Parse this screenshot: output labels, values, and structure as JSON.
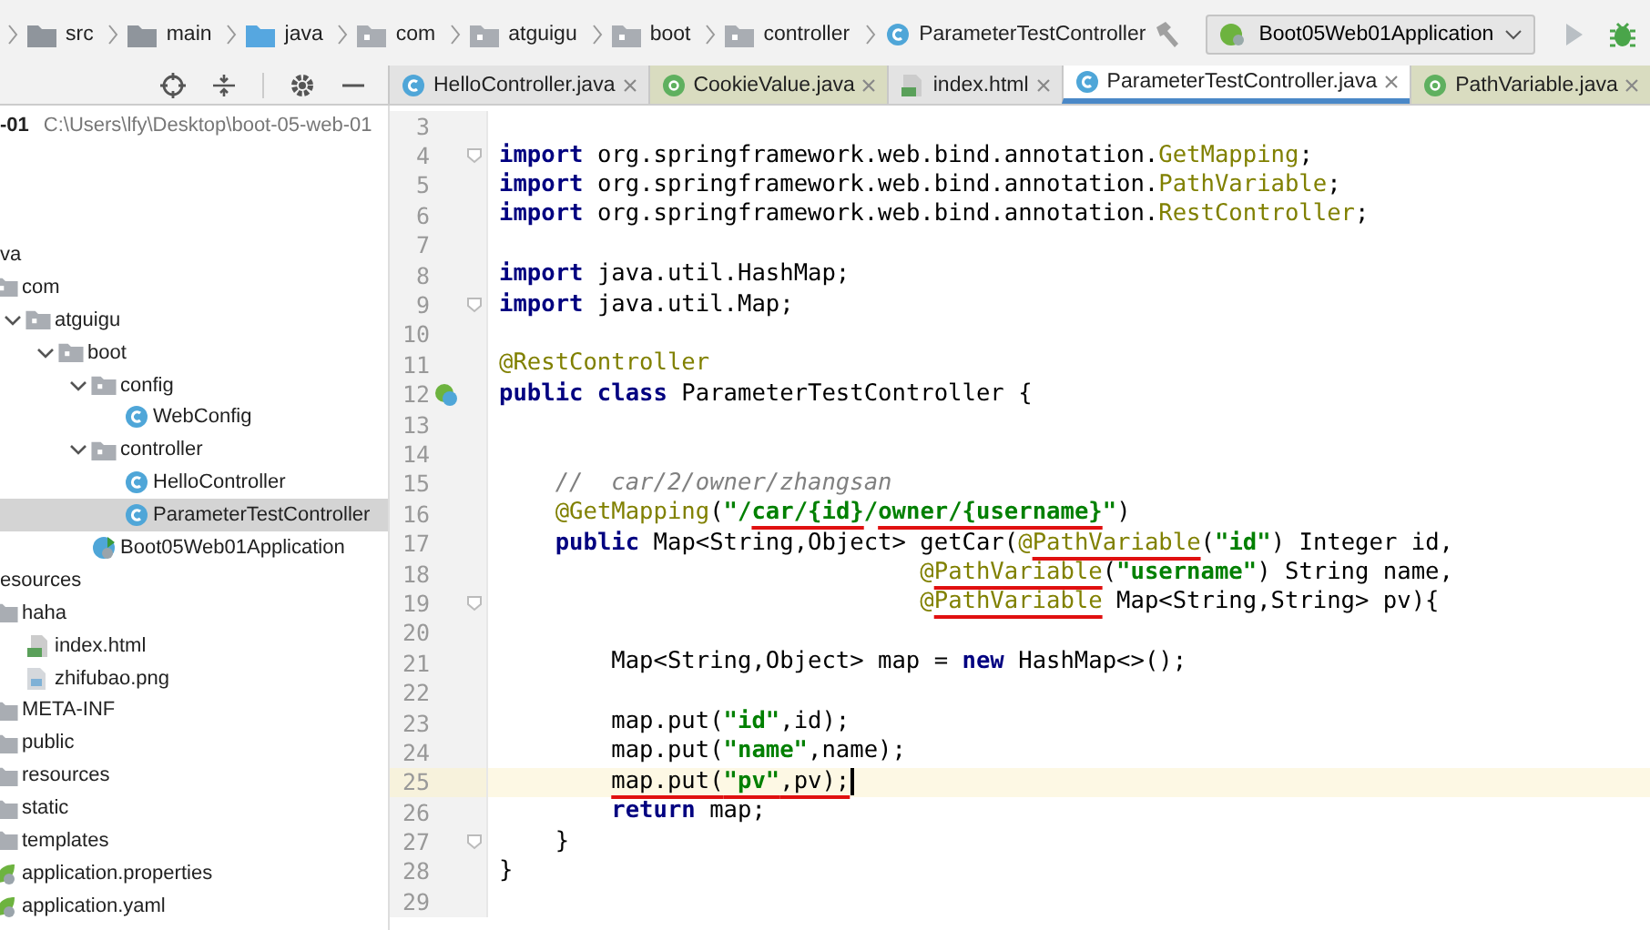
{
  "breadcrumb": [
    {
      "label": "src",
      "kind": "folder"
    },
    {
      "label": "main",
      "kind": "folder"
    },
    {
      "label": "java",
      "kind": "source"
    },
    {
      "label": "com",
      "kind": "package"
    },
    {
      "label": "atguigu",
      "kind": "package"
    },
    {
      "label": "boot",
      "kind": "package"
    },
    {
      "label": "controller",
      "kind": "package"
    },
    {
      "label": "ParameterTestController",
      "kind": "class"
    }
  ],
  "run_config": {
    "label": "Boot05Web01Application"
  },
  "tabs": [
    {
      "label": "HelloController.java",
      "kind": "class",
      "selected": false
    },
    {
      "label": "CookieValue.java",
      "kind": "annotation",
      "selected": false
    },
    {
      "label": "index.html",
      "kind": "html",
      "selected": false
    },
    {
      "label": "ParameterTestController.java",
      "kind": "class",
      "selected": true
    },
    {
      "label": "PathVariable.java",
      "kind": "annotation",
      "selected": false
    }
  ],
  "project": {
    "name": "-01",
    "path": "C:\\Users\\lfy\\Desktop\\boot-05-web-01"
  },
  "tree": [
    {
      "label": "va",
      "kind": "none",
      "selected": false,
      "children": [
        {
          "label": "com",
          "kind": "package",
          "selected": false,
          "children": [
            {
              "label": "atguigu",
              "kind": "package",
              "expanded": true,
              "selected": false,
              "children": [
                {
                  "label": "boot",
                  "kind": "package",
                  "expanded": true,
                  "selected": false,
                  "children": [
                    {
                      "label": "config",
                      "kind": "package",
                      "expanded": true,
                      "selected": false,
                      "children": [
                        {
                          "label": "WebConfig",
                          "kind": "class",
                          "selected": false
                        }
                      ]
                    },
                    {
                      "label": "controller",
                      "kind": "package",
                      "expanded": true,
                      "selected": false,
                      "children": [
                        {
                          "label": "HelloController",
                          "kind": "class",
                          "selected": false
                        },
                        {
                          "label": "ParameterTestController",
                          "kind": "class",
                          "selected": true
                        }
                      ]
                    },
                    {
                      "label": "Boot05Web01Application",
                      "kind": "app",
                      "selected": false
                    }
                  ]
                }
              ]
            }
          ]
        }
      ]
    },
    {
      "label": "esources",
      "kind": "none",
      "selected": false,
      "children": [
        {
          "label": "haha",
          "kind": "folder",
          "selected": false,
          "children": [
            {
              "label": "index.html",
              "kind": "html",
              "selected": false
            },
            {
              "label": "zhifubao.png",
              "kind": "image",
              "selected": false
            }
          ]
        },
        {
          "label": "META-INF",
          "kind": "folder",
          "selected": false
        },
        {
          "label": "public",
          "kind": "folder",
          "selected": false
        },
        {
          "label": "resources",
          "kind": "folder",
          "selected": false
        },
        {
          "label": "static",
          "kind": "folder",
          "selected": false
        },
        {
          "label": "templates",
          "kind": "folder",
          "selected": false
        },
        {
          "label": "application.properties",
          "kind": "config",
          "selected": false
        },
        {
          "label": "application.yaml",
          "kind": "config",
          "selected": false
        }
      ]
    }
  ],
  "code": [
    {
      "number": "3"
    },
    {
      "number": "4",
      "fold": true,
      "tokens": [
        {
          "t": "import",
          "kind": "keyword"
        },
        {
          "t": " org.springframework.web.bind.annotation.",
          "kind": "plain"
        },
        {
          "t": "GetMapping",
          "kind": "annotation"
        },
        {
          "t": ";",
          "kind": "plain"
        }
      ]
    },
    {
      "number": "5",
      "tokens": [
        {
          "t": "import",
          "kind": "keyword"
        },
        {
          "t": " org.springframework.web.bind.annotation.",
          "kind": "plain"
        },
        {
          "t": "PathVariable",
          "kind": "annotation"
        },
        {
          "t": ";",
          "kind": "plain"
        }
      ]
    },
    {
      "number": "6",
      "tokens": [
        {
          "t": "import",
          "kind": "keyword"
        },
        {
          "t": " org.springframework.web.bind.annotation.",
          "kind": "plain"
        },
        {
          "t": "RestController",
          "kind": "annotation"
        },
        {
          "t": ";",
          "kind": "plain"
        }
      ]
    },
    {
      "number": "7"
    },
    {
      "number": "8",
      "tokens": [
        {
          "t": "import",
          "kind": "keyword"
        },
        {
          "t": " java.util.HashMap;",
          "kind": "plain"
        }
      ]
    },
    {
      "number": "9",
      "fold": true,
      "tokens": [
        {
          "t": "import",
          "kind": "keyword"
        },
        {
          "t": " java.util.Map;",
          "kind": "plain"
        }
      ]
    },
    {
      "number": "10"
    },
    {
      "number": "11",
      "tokens": [
        {
          "t": "@RestController",
          "kind": "annotation"
        }
      ]
    },
    {
      "number": "12",
      "gutter": {
        "kind": "bean"
      },
      "tokens": [
        {
          "t": "public class",
          "kind": "keyword"
        },
        {
          "t": " ParameterTestController {",
          "kind": "plain"
        }
      ]
    },
    {
      "number": "13"
    },
    {
      "number": "14"
    },
    {
      "number": "15",
      "tokens": [
        {
          "t": "    //  car/2/owner/zhangsan",
          "kind": "comment"
        }
      ]
    },
    {
      "number": "16",
      "tokens": [
        {
          "t": "    @GetMapping",
          "kind": "annotation"
        },
        {
          "t": "(",
          "kind": "plain"
        },
        {
          "t": "\"/",
          "kind": "string"
        },
        {
          "t": "car/{id}",
          "kind": "string",
          "marked": true
        },
        {
          "t": "/",
          "kind": "string"
        },
        {
          "t": "owner/{username}",
          "kind": "string",
          "marked": true
        },
        {
          "t": "\"",
          "kind": "string"
        },
        {
          "t": ")",
          "kind": "plain"
        }
      ]
    },
    {
      "number": "17",
      "tokens": [
        {
          "t": "    public",
          "kind": "keyword"
        },
        {
          "t": " Map<String,Object> getCar(",
          "kind": "plain"
        },
        {
          "t": "@",
          "kind": "annotation"
        },
        {
          "t": "PathVariable",
          "kind": "annotation",
          "marked": true
        },
        {
          "t": "(",
          "kind": "plain"
        },
        {
          "t": "\"id\"",
          "kind": "string"
        },
        {
          "t": ") Integer id,",
          "kind": "plain"
        }
      ]
    },
    {
      "number": "18",
      "tokens": [
        {
          "t": "                              @",
          "kind": "annotation"
        },
        {
          "t": "PathVariable",
          "kind": "annotation",
          "marked": true
        },
        {
          "t": "(",
          "kind": "plain"
        },
        {
          "t": "\"username\"",
          "kind": "string"
        },
        {
          "t": ") String name,",
          "kind": "plain"
        }
      ]
    },
    {
      "number": "19",
      "fold": true,
      "tokens": [
        {
          "t": "                              @",
          "kind": "annotation"
        },
        {
          "t": "PathVariable",
          "kind": "annotation",
          "marked": true
        },
        {
          "t": " Map<String,String> pv){",
          "kind": "plain"
        }
      ]
    },
    {
      "number": "20"
    },
    {
      "number": "21",
      "tokens": [
        {
          "t": "        Map<String,Object> map = ",
          "kind": "plain"
        },
        {
          "t": "new",
          "kind": "keyword"
        },
        {
          "t": " HashMap<>();",
          "kind": "plain"
        }
      ]
    },
    {
      "number": "22"
    },
    {
      "number": "23",
      "tokens": [
        {
          "t": "        map.put(",
          "kind": "plain"
        },
        {
          "t": "\"id\"",
          "kind": "string"
        },
        {
          "t": ",id);",
          "kind": "plain"
        }
      ]
    },
    {
      "number": "24",
      "tokens": [
        {
          "t": "        map.put(",
          "kind": "plain"
        },
        {
          "t": "\"name\"",
          "kind": "string"
        },
        {
          "t": ",name);",
          "kind": "plain"
        }
      ]
    },
    {
      "number": "25",
      "current": true,
      "caret": true,
      "tokens": [
        {
          "t": "        map.put(",
          "kind": "plain",
          "marked": true
        },
        {
          "t": "\"pv\"",
          "kind": "string",
          "marked": true
        },
        {
          "t": ",pv);",
          "kind": "plain",
          "marked": true
        }
      ]
    },
    {
      "number": "26",
      "tokens": [
        {
          "t": "        return",
          "kind": "keyword"
        },
        {
          "t": " map;",
          "kind": "plain"
        }
      ]
    },
    {
      "number": "27",
      "fold": true,
      "tokens": [
        {
          "t": "    }",
          "kind": "plain"
        }
      ]
    },
    {
      "number": "28",
      "tokens": [
        {
          "t": "}",
          "kind": "plain"
        }
      ]
    },
    {
      "number": "29"
    }
  ]
}
